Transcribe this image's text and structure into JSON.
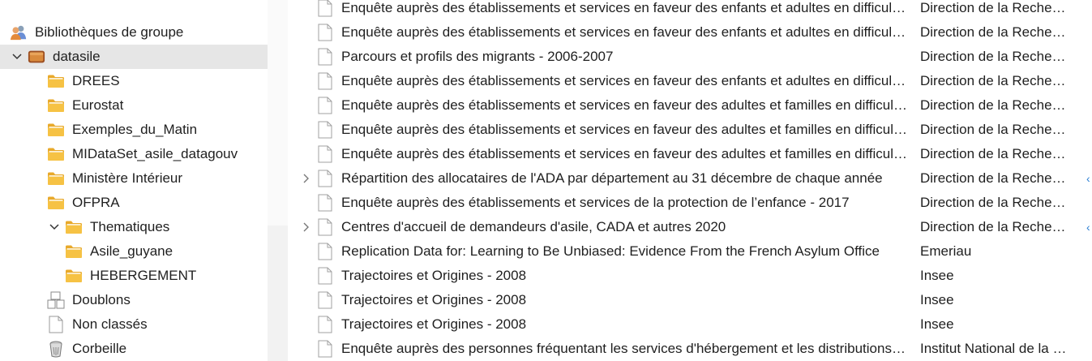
{
  "sidebar": {
    "items": [
      {
        "label": "Bibliothèques de groupe",
        "icon": "group-libraries-icon",
        "twisty": ""
      },
      {
        "label": "datasile",
        "icon": "group-library-icon",
        "twisty": "expanded"
      },
      {
        "label": "DREES",
        "icon": "folder-icon",
        "twisty": ""
      },
      {
        "label": "Eurostat",
        "icon": "folder-icon",
        "twisty": ""
      },
      {
        "label": "Exemples_du_Matin",
        "icon": "folder-icon",
        "twisty": ""
      },
      {
        "label": "MIDataSet_asile_datagouv",
        "icon": "folder-icon",
        "twisty": ""
      },
      {
        "label": "Ministère Intérieur",
        "icon": "folder-icon",
        "twisty": ""
      },
      {
        "label": "OFPRA",
        "icon": "folder-icon",
        "twisty": ""
      },
      {
        "label": "Thematiques",
        "icon": "folder-icon",
        "twisty": "expanded"
      },
      {
        "label": "Asile_guyane",
        "icon": "folder-icon",
        "twisty": ""
      },
      {
        "label": "HEBERGEMENT",
        "icon": "folder-icon",
        "twisty": ""
      },
      {
        "label": "Doublons",
        "icon": "duplicates-icon",
        "twisty": ""
      },
      {
        "label": "Non classés",
        "icon": "unfiled-icon",
        "twisty": ""
      },
      {
        "label": "Corbeille",
        "icon": "trash-icon",
        "twisty": ""
      }
    ]
  },
  "items": [
    {
      "title": "Enquête auprès des établissements et services en faveur des enfants et adultes en difficulté sociale",
      "creator": "Direction de la Recherche",
      "has_children": false,
      "badge": ""
    },
    {
      "title": "Enquête auprès des établissements et services en faveur des enfants et adultes en difficulté sociale",
      "creator": "Direction de la Recherche",
      "has_children": false,
      "badge": ""
    },
    {
      "title": "Parcours et profils des migrants - 2006-2007",
      "creator": "Direction de la Recherche",
      "has_children": false,
      "badge": ""
    },
    {
      "title": "Enquête auprès des établissements et services en faveur des enfants et adultes en difficulté sociale",
      "creator": "Direction de la Recherche",
      "has_children": false,
      "badge": ""
    },
    {
      "title": "Enquête auprès des établissements et services en faveur des adultes et familles en difficulté sociale",
      "creator": "Direction de la Recherche",
      "has_children": false,
      "badge": ""
    },
    {
      "title": "Enquête auprès des établissements et services en faveur des adultes et familles en difficulté sociale",
      "creator": "Direction de la Recherche",
      "has_children": false,
      "badge": ""
    },
    {
      "title": "Enquête auprès des établissements et services en faveur des adultes et familles en difficulté sociale",
      "creator": "Direction de la Recherche",
      "has_children": false,
      "badge": ""
    },
    {
      "title": "Répartition des allocataires de l'ADA par département au 31 décembre de chaque année",
      "creator": "Direction de la Recherche",
      "has_children": true,
      "badge": "‹"
    },
    {
      "title": "Enquête auprès des établissements et services de la protection de l’enfance - 2017",
      "creator": "Direction de la Recherche",
      "has_children": false,
      "badge": ""
    },
    {
      "title": "Centres d'accueil de demandeurs d'asile, CADA et autres 2020",
      "creator": "Direction de la Recherche",
      "has_children": true,
      "badge": "‹"
    },
    {
      "title": "Replication Data for: Learning to Be Unbiased: Evidence From the French Asylum Office",
      "creator": "Emeriau",
      "has_children": false,
      "badge": ""
    },
    {
      "title": "Trajectoires et Origines - 2008",
      "creator": "Insee",
      "has_children": false,
      "badge": ""
    },
    {
      "title": "Trajectoires et Origines - 2008",
      "creator": "Insee",
      "has_children": false,
      "badge": ""
    },
    {
      "title": "Trajectoires et Origines - 2008",
      "creator": "Insee",
      "has_children": false,
      "badge": ""
    },
    {
      "title": "Enquête auprès des personnes fréquentant les services d'hébergement et les distributions de repas",
      "creator": "Institut National de la Statistique",
      "has_children": false,
      "badge": ""
    }
  ],
  "colors": {
    "folder": "#f6c244",
    "selected_row": "#e6e6e6",
    "accent": "#2a7fd4"
  }
}
